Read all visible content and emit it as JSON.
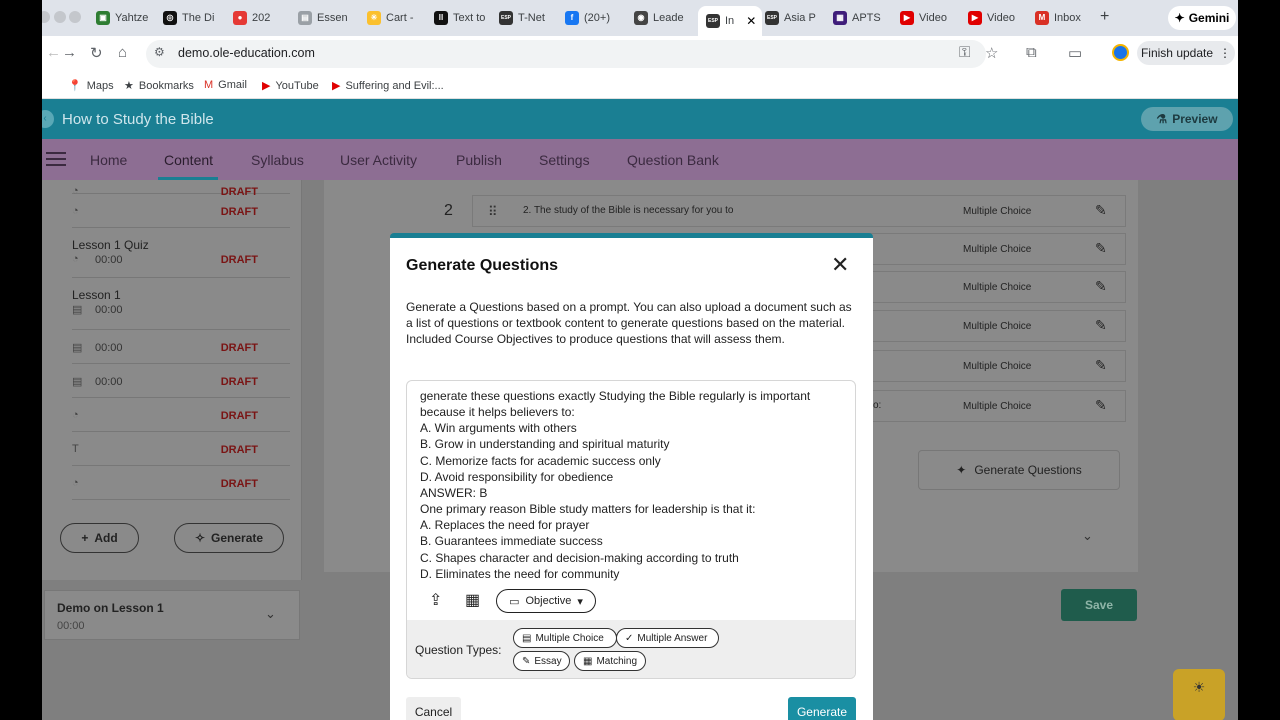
{
  "browser": {
    "tabs": [
      {
        "label": "Yahtze",
        "fav_color": "#2e7d32",
        "fav_glyph": "▣"
      },
      {
        "label": "The Di",
        "fav_color": "#111111",
        "fav_glyph": "◎"
      },
      {
        "label": "202",
        "fav_color": "#e53935",
        "fav_glyph": "●"
      },
      {
        "label": "Essen",
        "fav_color": "#9aa0a6",
        "fav_glyph": "▤"
      },
      {
        "label": "Cart -",
        "fav_color": "#fbc02d",
        "fav_glyph": "✳"
      },
      {
        "label": "Text to",
        "fav_color": "#111111",
        "fav_glyph": "ll"
      },
      {
        "label": "T-Net",
        "fav_color": "#333333",
        "fav_glyph": "ESP"
      },
      {
        "label": "(20+)",
        "fav_color": "#1877f2",
        "fav_glyph": "f"
      },
      {
        "label": "Leade",
        "fav_color": "#444444",
        "fav_glyph": "◉"
      },
      {
        "label": "In",
        "fav_color": "#333333",
        "fav_glyph": "ESP"
      },
      {
        "label": "Asia P",
        "fav_color": "#333333",
        "fav_glyph": "ESP"
      },
      {
        "label": "APTS",
        "fav_color": "#3f1d7a",
        "fav_glyph": "▦"
      },
      {
        "label": "Video",
        "fav_color": "#e00000",
        "fav_glyph": "▶"
      },
      {
        "label": "Video",
        "fav_color": "#e00000",
        "fav_glyph": "▶"
      },
      {
        "label": "Inbox",
        "fav_color": "#d93025",
        "fav_glyph": "M"
      }
    ],
    "active_tab_close": "✕",
    "new_tab": "+",
    "gemini_label": "Gemini",
    "url": "demo.ole-education.com",
    "finish_update": "Finish update",
    "bookmarks": [
      {
        "label": "Maps",
        "icon": "📍"
      },
      {
        "label": "Bookmarks",
        "icon": "★"
      },
      {
        "label": "Gmail",
        "icon": "M"
      },
      {
        "label": "YouTube",
        "icon": "▶"
      },
      {
        "label": "Suffering and Evil:...",
        "icon": "▶"
      }
    ]
  },
  "app": {
    "title": "How to Study the Bible",
    "preview_label": "Preview",
    "nav": [
      "Home",
      "Content",
      "Syllabus",
      "User Activity",
      "Publish",
      "Settings",
      "Question Bank"
    ],
    "active_nav": "Content"
  },
  "sidebar": {
    "rows": [
      {
        "name": "",
        "time": "",
        "status": "DRAFT",
        "icon": "◔"
      },
      {
        "name": "",
        "time": "",
        "status": "DRAFT",
        "icon": "◔"
      },
      {
        "name": "Lesson 1 Quiz",
        "time": "00:00",
        "status": "DRAFT",
        "icon": "◔"
      },
      {
        "name": "Lesson 1",
        "time": "00:00",
        "status": "",
        "icon": "▤"
      },
      {
        "name": "",
        "time": "00:00",
        "status": "DRAFT",
        "icon": "▤"
      },
      {
        "name": "",
        "time": "00:00",
        "status": "DRAFT",
        "icon": "▤"
      },
      {
        "name": "",
        "time": "",
        "status": "DRAFT",
        "icon": "◔"
      },
      {
        "name": "",
        "time": "",
        "status": "DRAFT",
        "icon": "T"
      },
      {
        "name": "",
        "time": "",
        "status": "DRAFT",
        "icon": "◔"
      }
    ],
    "add_label": "Add",
    "generate_label": "Generate",
    "demo_title": "Demo on Lesson 1",
    "demo_time": "00:00"
  },
  "questions": {
    "row_number": "2",
    "first_text": "2. The study of the Bible is necessary for you to",
    "partial_text": "o:",
    "type_label": "Multiple Choice",
    "generate_questions_label": "Generate Questions",
    "save_label": "Save"
  },
  "modal": {
    "title": "Generate Questions",
    "description": "Generate a Questions based on a prompt. You can also upload a document such as a list of questions or textbook content to generate questions based on the material. Included Course Objectives to produce questions that will assess them.",
    "prompt": "generate these questions exactly Studying the Bible regularly is important because it helps believers to:\nA. Win arguments with others\nB. Grow in understanding and spiritual maturity\nC. Memorize facts for academic success only\nD. Avoid responsibility for obedience\nANSWER: B\nOne primary reason Bible study matters for leadership is that it:\nA. Replaces the need for prayer\nB. Guarantees immediate success\nC. Shapes character and decision-making according to truth\nD. Eliminates the need for community",
    "objective_label": "Objective",
    "question_types_label": "Question Types:",
    "types": [
      {
        "label": "Multiple Choice",
        "icon": "▤"
      },
      {
        "label": "Multiple Answer",
        "icon": "✓"
      },
      {
        "label": "Essay",
        "icon": "✎"
      },
      {
        "label": "Matching",
        "icon": "▦"
      }
    ],
    "cancel_label": "Cancel",
    "generate_label": "Generate"
  },
  "colors": {
    "teal": "#1a7f93",
    "purple_nav": "#8d6e93",
    "draft_red": "#7a1414",
    "generate_button": "#1a8fa3"
  }
}
